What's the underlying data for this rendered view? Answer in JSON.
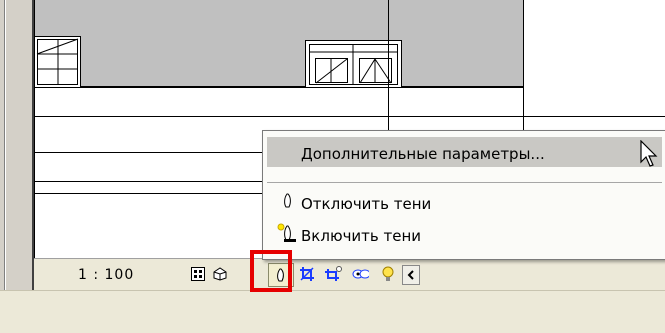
{
  "status_bar": {
    "scale": "1 : 100",
    "icons": [
      "detail-level-icon",
      "visual-style-icon",
      "shadows-icon",
      "crop-region-icon",
      "crop-visibility-icon",
      "hidden-elements-icon",
      "temporary-isolate-icon",
      "scroll-left-icon"
    ]
  },
  "context_menu": {
    "items": [
      {
        "label": "Дополнительные параметры...",
        "highlighted": true
      },
      {
        "label": "Отключить тени",
        "icon": "shadow-off-icon"
      },
      {
        "label": "Включить тени",
        "icon": "shadow-on-icon"
      }
    ]
  },
  "colors": {
    "annotation": "#e60000",
    "menu_highlight": "#c9c8c4",
    "wall_fill": "#c0c0c0"
  }
}
